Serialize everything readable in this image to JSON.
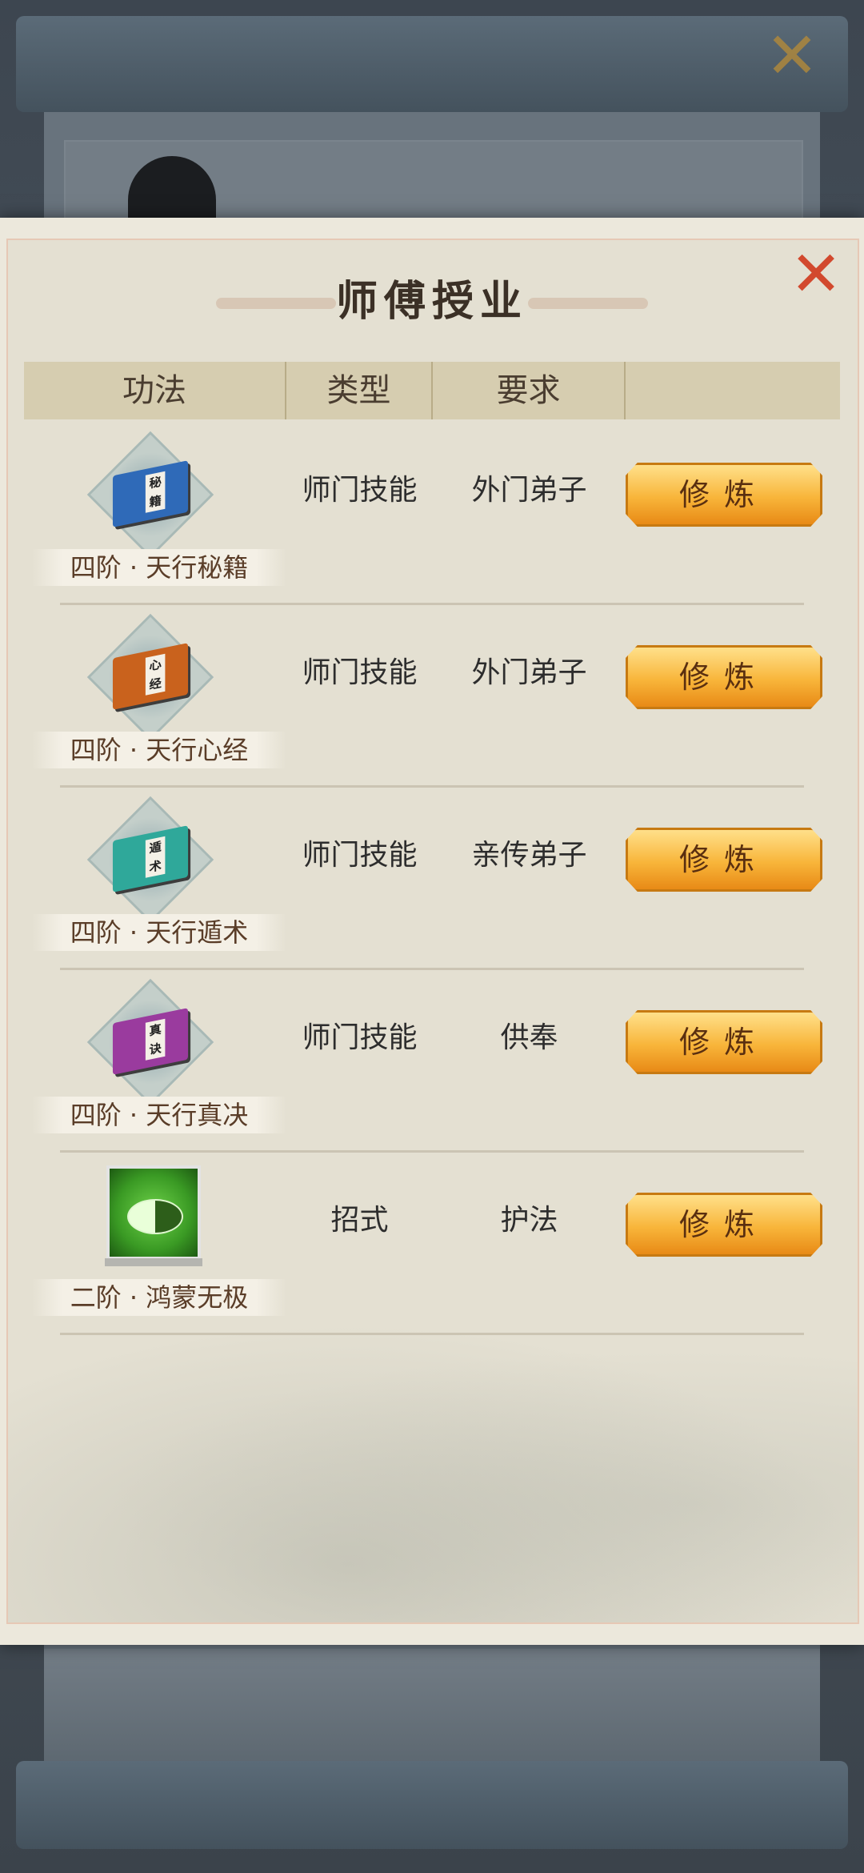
{
  "dialog": {
    "title": "师傅授业",
    "close_icon": "close-icon"
  },
  "table": {
    "headers": [
      "功法",
      "类型",
      "要求",
      ""
    ],
    "rows": [
      {
        "name": "四阶 · 天行秘籍",
        "type": "师门技能",
        "requirement": "外门弟子",
        "button": "修炼",
        "icon": "blue-book-icon",
        "icon_label": "秘籍",
        "color": "#2f6ab8"
      },
      {
        "name": "四阶 · 天行心经",
        "type": "师门技能",
        "requirement": "外门弟子",
        "button": "修炼",
        "icon": "orange-book-icon",
        "icon_label": "心经",
        "color": "#c9621d"
      },
      {
        "name": "四阶 · 天行遁术",
        "type": "师门技能",
        "requirement": "亲传弟子",
        "button": "修炼",
        "icon": "teal-book-icon",
        "icon_label": "遁术",
        "color": "#2fa89a"
      },
      {
        "name": "四阶 · 天行真决",
        "type": "师门技能",
        "requirement": "供奉",
        "button": "修炼",
        "icon": "purple-book-icon",
        "icon_label": "真诀",
        "color": "#9a3b9e"
      },
      {
        "name": "二阶 · 鸿蒙无极",
        "type": "招式",
        "requirement": "护法",
        "button": "修炼",
        "icon": "yin-yang-icon",
        "icon_label": "",
        "color": "#3a9a24"
      }
    ]
  }
}
